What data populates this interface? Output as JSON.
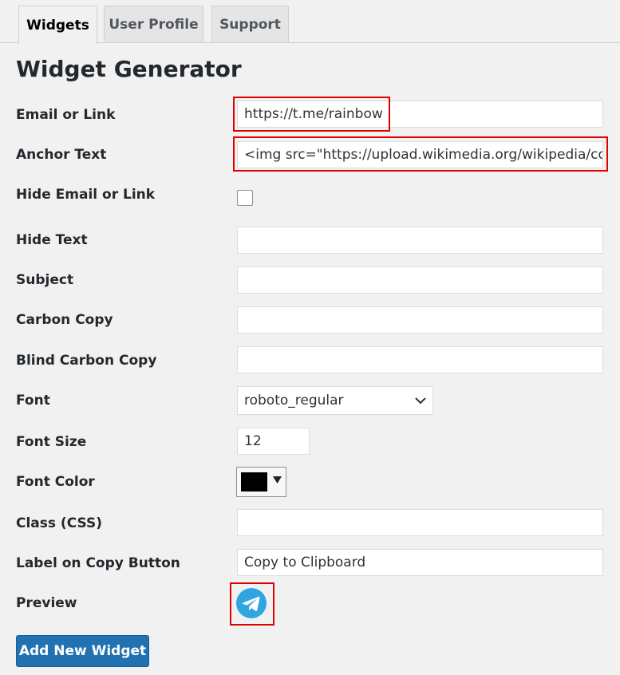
{
  "tabs": [
    {
      "label": "Widgets",
      "active": true
    },
    {
      "label": "User Profile",
      "active": false
    },
    {
      "label": "Support",
      "active": false
    }
  ],
  "page_title": "Widget Generator",
  "form": {
    "email_or_link": {
      "label": "Email or Link",
      "value": "https://t.me/rainbow"
    },
    "anchor_text": {
      "label": "Anchor Text",
      "value": "<img src=\"https://upload.wikimedia.org/wikipedia/commons/"
    },
    "hide_email": {
      "label": "Hide Email or Link",
      "checked": false
    },
    "hide_text": {
      "label": "Hide Text",
      "value": ""
    },
    "subject": {
      "label": "Subject",
      "value": ""
    },
    "carbon_copy": {
      "label": "Carbon Copy",
      "value": ""
    },
    "blind_carbon_copy": {
      "label": "Blind Carbon Copy",
      "value": ""
    },
    "font": {
      "label": "Font",
      "selected": "roboto_regular"
    },
    "font_size": {
      "label": "Font Size",
      "value": "12"
    },
    "font_color": {
      "label": "Font Color",
      "color": "#000000"
    },
    "class_css": {
      "label": "Class (CSS)",
      "value": ""
    },
    "copy_button_label": {
      "label": "Label on Copy Button",
      "value": "Copy to Clipboard"
    },
    "preview": {
      "label": "Preview",
      "icon": "telegram-icon"
    }
  },
  "add_button_label": "Add New Widget",
  "colors": {
    "highlight": "#e00000",
    "primary_button": "#2271b1",
    "telegram_blue": "#2ea6e0"
  }
}
